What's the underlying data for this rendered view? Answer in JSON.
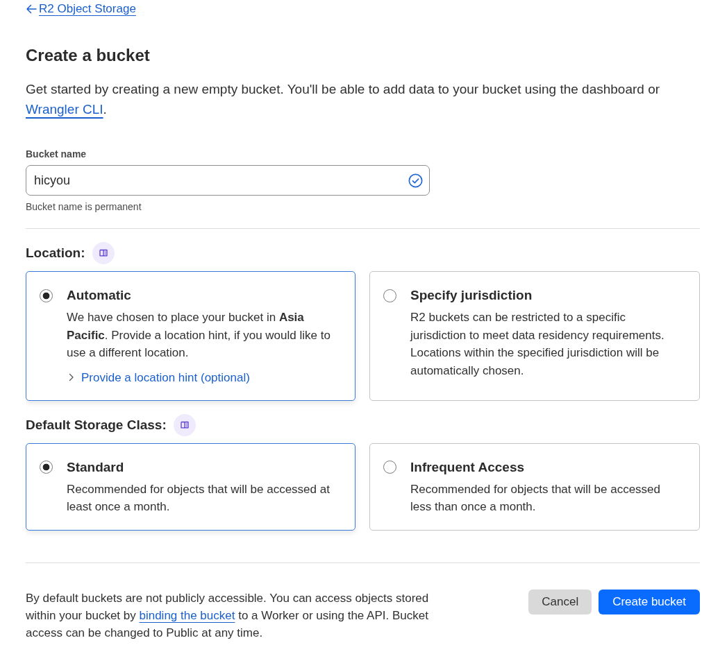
{
  "back_link": {
    "label": "R2 Object Storage"
  },
  "title": "Create a bucket",
  "intro": {
    "text": "Get started by creating a new empty bucket. You'll be able to add data to your bucket using the dashboard or",
    "link": "Wrangler CLI",
    "suffix": "."
  },
  "bucket_name": {
    "label": "Bucket name",
    "value": "hicyou",
    "valid": true,
    "hint": "Bucket name is permanent"
  },
  "location": {
    "label": "Location:",
    "options": [
      {
        "title": "Automatic",
        "description": "We have chosen to place your bucket in **Asia Pacific**. Provide a location hint, if you would like to use a different location.",
        "hint": {
          "label": "Provide a location hint (optional)",
          "expanded": false
        },
        "selected": true
      },
      {
        "title": "Specify jurisdiction",
        "description": "R2 buckets can be restricted to a specific jurisdiction to meet data residency requirements. Locations within the specified jurisdiction will be automatically chosen.",
        "selected": false
      }
    ]
  },
  "storage_class": {
    "label": "Default Storage Class:",
    "options": [
      {
        "title": "Standard",
        "description": "Recommended for objects that will be accessed at least once a month.",
        "selected": true
      },
      {
        "title": "Infrequent Access",
        "description": "Recommended for objects that will be accessed less than once a month.",
        "selected": false
      }
    ]
  },
  "footer": {
    "text_before": "By default buckets are not publicly accessible. You can access objects stored within your bucket by",
    "link": "binding the bucket",
    "text_after": "to a Worker or using the API. Bucket access can be changed to Public at any time."
  },
  "buttons": [
    {
      "label": "Cancel",
      "kind": "secondary"
    },
    {
      "label": "Create bucket",
      "kind": "primary"
    }
  ]
}
